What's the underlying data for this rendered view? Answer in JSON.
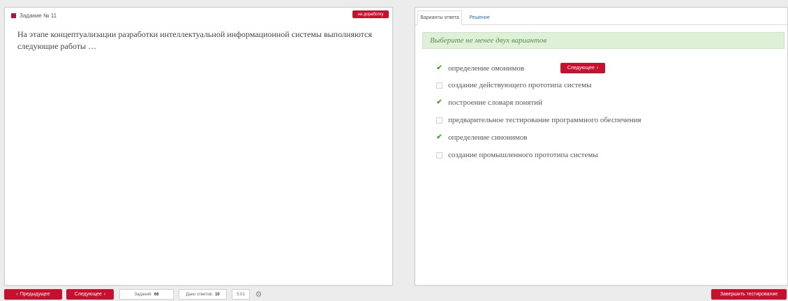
{
  "task": {
    "header": "Задание № 11",
    "mark_button": "на доработку",
    "question": "На этапе концептуализации разработки интеллектуальной информационной системы выполняются следующие работы …"
  },
  "answer_panel": {
    "tabs": [
      "Варианты ответа",
      "Решение"
    ],
    "hint": "Выберите не менее двух вариантов",
    "options": [
      {
        "label": "определение омонимов",
        "checked": true
      },
      {
        "label": "создание действующего прототипа системы",
        "checked": false
      },
      {
        "label": "построение словаря понятий",
        "checked": true
      },
      {
        "label": "предварительное тестирование программного обеспечения",
        "checked": false
      },
      {
        "label": "определение синонимов",
        "checked": true
      },
      {
        "label": "создание промышленного прототипа системы",
        "checked": false
      }
    ],
    "next_inline_label": "Следующее"
  },
  "bottom": {
    "prev_label": "Предыдущее",
    "next_label": "Следующее",
    "tasks_label": "Заданий:",
    "tasks_value": "66",
    "answered_label": "Дано ответов:",
    "answered_value": "10",
    "timer": "5:01",
    "finish_label": "Завершить тестирование"
  },
  "colors": {
    "accent_red": "#c8102e",
    "hint_bg": "#dff0d8",
    "check_green": "#4aa02c"
  },
  "icons": [
    "flag-icon",
    "check-icon",
    "chevron-right-icon",
    "chevron-left-icon",
    "gear-icon"
  ]
}
